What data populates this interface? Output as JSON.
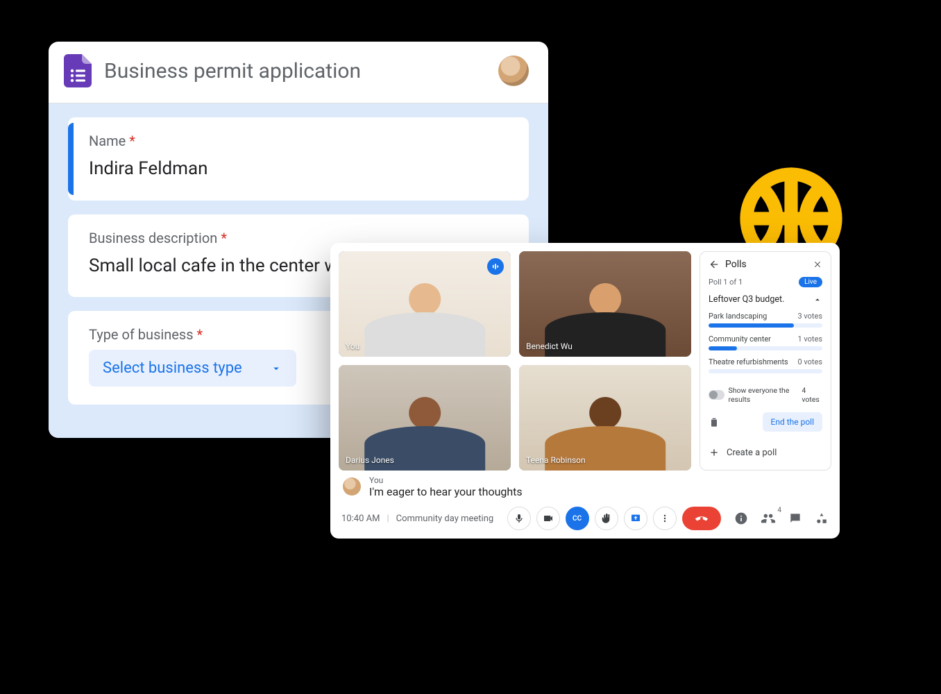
{
  "form": {
    "title": "Business permit application",
    "questions": {
      "name": {
        "label": "Name",
        "required_mark": "*",
        "answer": "Indira Feldman"
      },
      "desc": {
        "label": "Business description",
        "required_mark": "*",
        "answer": "Small local cafe in the center with an onsite bakery."
      },
      "type": {
        "label": "Type of business",
        "required_mark": "*",
        "select_placeholder": "Select business type"
      }
    }
  },
  "meet": {
    "time": "10:40 AM",
    "meeting_name": "Community day meeting",
    "cc_label": "CC",
    "participant_count": "4",
    "tiles": [
      {
        "name": "You"
      },
      {
        "name": "Benedict Wu"
      },
      {
        "name": "Darius Jones"
      },
      {
        "name": "Teena Robinson"
      }
    ],
    "caption": {
      "speaker": "You",
      "text": "I'm eager to hear your thoughts"
    },
    "polls": {
      "title": "Polls",
      "counter": "Poll 1 of 1",
      "live": "Live",
      "question": "Leftover Q3 budget.",
      "options": [
        {
          "label": "Park landscaping",
          "votes": "3 votes",
          "pct": 75
        },
        {
          "label": "Community center",
          "votes": "1 votes",
          "pct": 25
        },
        {
          "label": "Theatre refurbishments",
          "votes": "0 votes",
          "pct": 0
        }
      ],
      "show_results_label": "Show everyone the results",
      "total_votes": "4 votes",
      "end_label": "End the poll",
      "create_label": "Create a poll"
    }
  }
}
